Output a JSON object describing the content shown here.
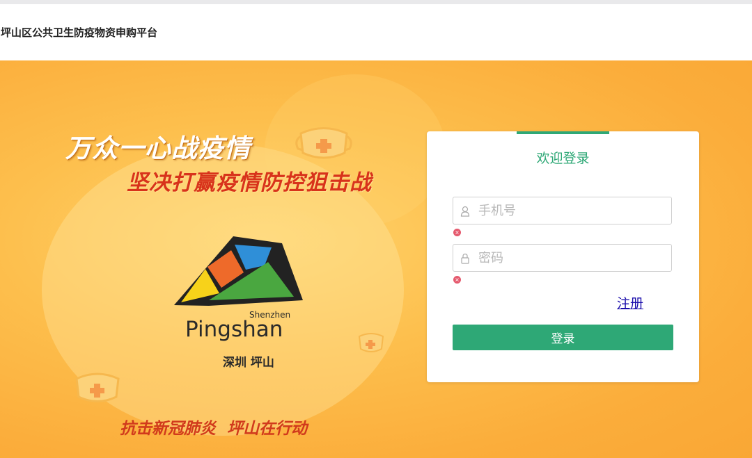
{
  "header": {
    "title": "坪山区公共卫生防疫物资申购平台"
  },
  "hero": {
    "slogan_main": "万众一心战疫情",
    "slogan_sub": "坚决打赢疫情防控狙击战",
    "slogan_bottom": "抗击新冠肺炎  坪山在行动",
    "logo": {
      "name_en": "Pingshan",
      "city_en": "Shenzhen",
      "name_cn": "深圳 坪山"
    }
  },
  "login": {
    "title": "欢迎登录",
    "phone": {
      "placeholder": "手机号",
      "value": "",
      "icon": "user-icon",
      "error_icon": "error-x-icon"
    },
    "password": {
      "placeholder": "密码",
      "value": "",
      "icon": "lock-icon",
      "error_icon": "error-x-icon"
    },
    "error_glyph": "×",
    "register_label": "注册",
    "submit_label": "登录"
  },
  "colors": {
    "accent": "#2ea876",
    "background": "#fbad3b",
    "slogan_red": "#d8331b",
    "link": "#1a0dab",
    "error": "#e55a6e"
  }
}
